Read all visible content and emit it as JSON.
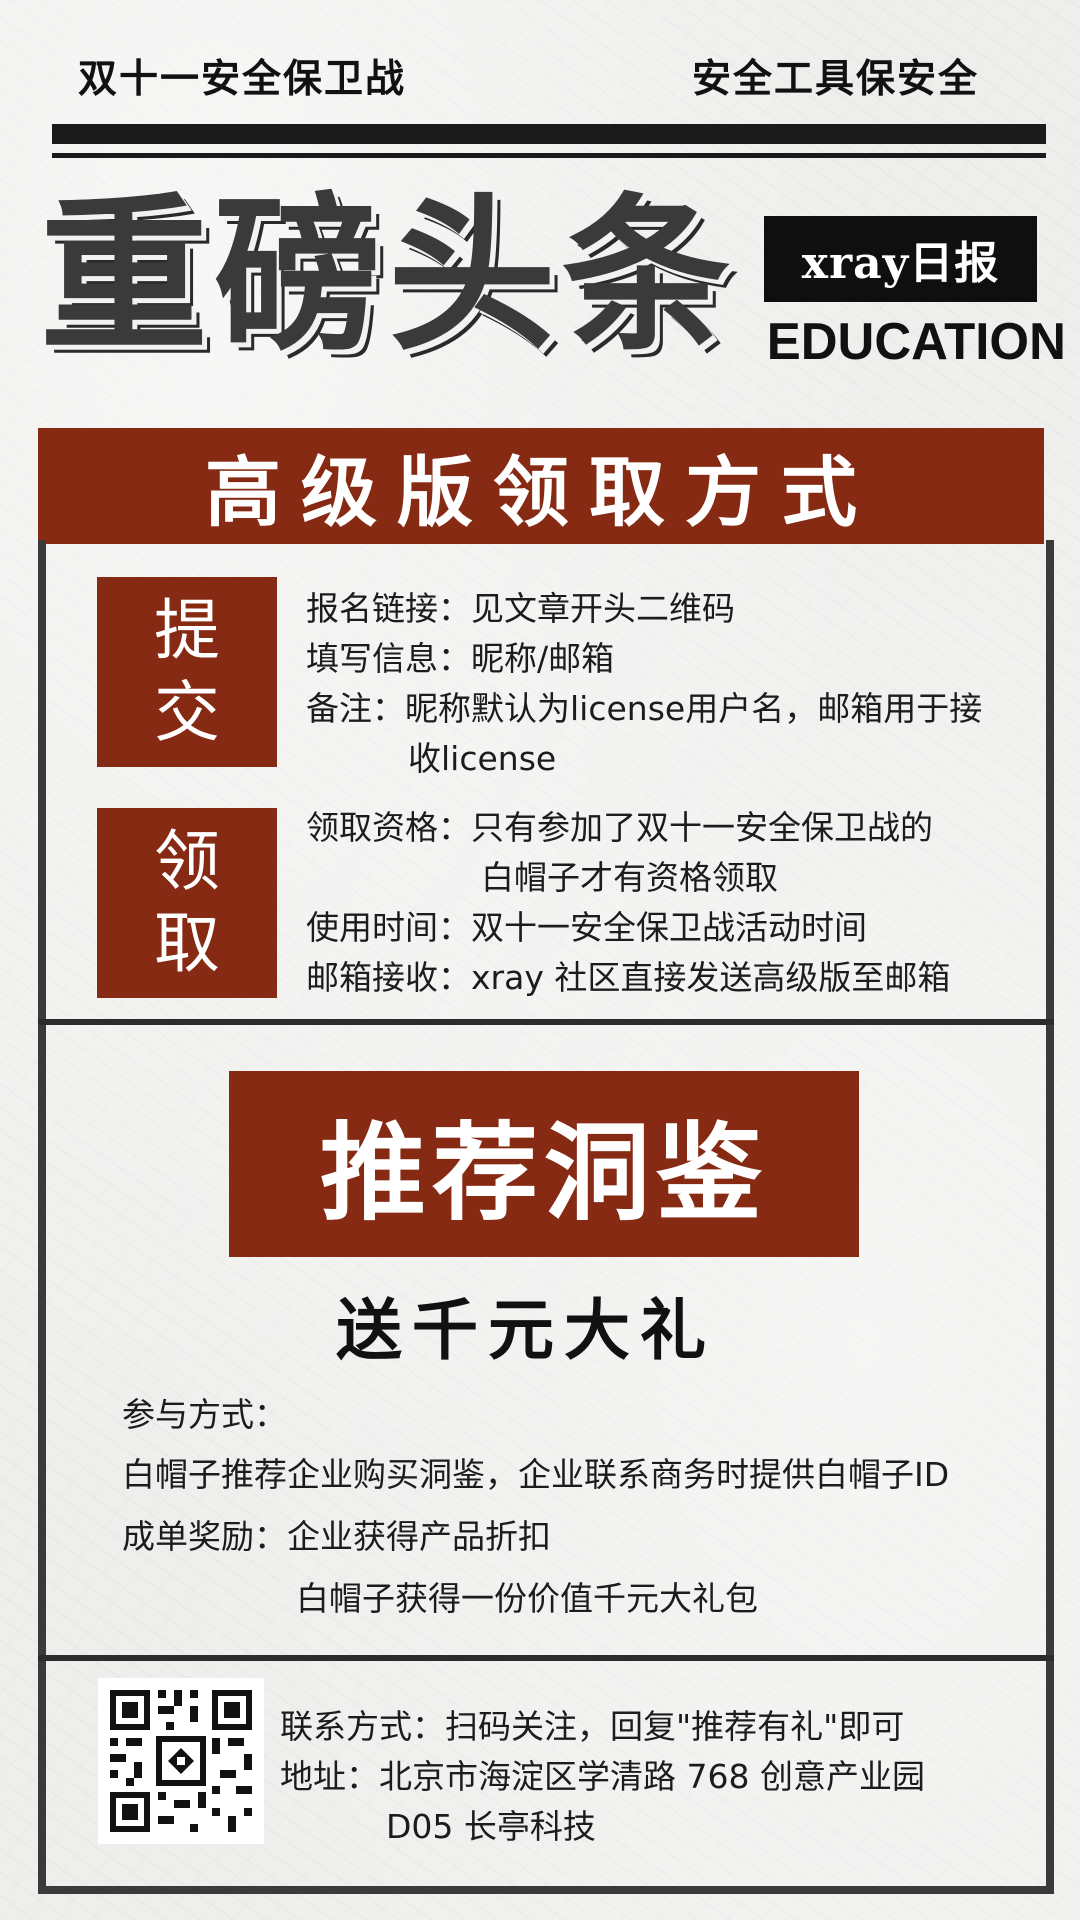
{
  "header": {
    "top_left": "双十一安全保卫战",
    "top_right": "安全工具保安全",
    "headline": "重磅头条",
    "badge": "xray日报",
    "badge_sub": "EDUCATION"
  },
  "banner": "高级版领取方式",
  "submit": {
    "tag_line1": "提",
    "tag_line2": "交",
    "lines": [
      "报名链接：见文章开头二维码",
      "填写信息：昵称/邮箱",
      "备注：昵称默认为license用户名，邮箱用于接",
      "收license"
    ]
  },
  "claim": {
    "tag_line1": "领",
    "tag_line2": "取",
    "lines": [
      "领取资格：只有参加了双十一安全保卫战的",
      "白帽子才有资格领取",
      "使用时间：双十一安全保卫战活动时间",
      "邮箱接收：xray 社区直接发送高级版至邮箱"
    ]
  },
  "recommend": {
    "title": "推荐洞鉴",
    "subtitle": "送千元大礼",
    "label": "参与方式：",
    "line1": "白帽子推荐企业购买洞鉴，企业联系商务时提供白帽子ID",
    "line2": "成单奖励：企业获得产品折扣",
    "line3": "白帽子获得一份价值千元大礼包"
  },
  "footer": {
    "contact": "联系方式：扫码关注，回复\"推荐有礼\"即可",
    "address1": "地址：北京市海淀区学清路 768 创意产业园",
    "address2": "D05 长亭科技",
    "qr_icon": "qr-code"
  },
  "colors": {
    "accent": "#862a13",
    "dark": "#1a1a1a",
    "background": "#eeeeec"
  }
}
